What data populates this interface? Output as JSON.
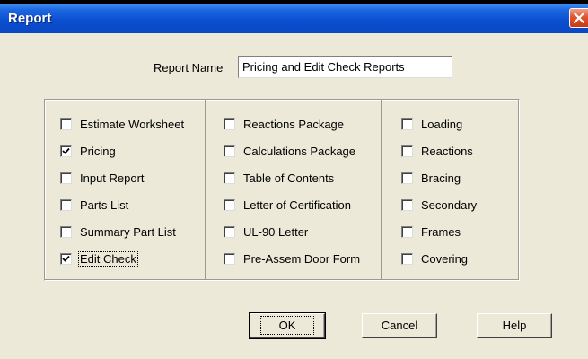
{
  "window": {
    "title": "Report",
    "close_icon": "close-icon"
  },
  "report_name": {
    "label": "Report Name",
    "value": "Pricing and Edit Check Reports"
  },
  "columns": [
    [
      {
        "label": "Estimate Worksheet",
        "checked": false
      },
      {
        "label": "Pricing",
        "checked": true
      },
      {
        "label": "Input Report",
        "checked": false
      },
      {
        "label": "Parts List",
        "checked": false
      },
      {
        "label": "Summary Part List",
        "checked": false
      },
      {
        "label": "Edit Check",
        "checked": true
      }
    ],
    [
      {
        "label": "Reactions Package",
        "checked": false
      },
      {
        "label": "Calculations Package",
        "checked": false
      },
      {
        "label": "Table of Contents",
        "checked": false
      },
      {
        "label": "Letter of Certification",
        "checked": false
      },
      {
        "label": "UL-90 Letter",
        "checked": false
      },
      {
        "label": "Pre-Assem Door Form",
        "checked": false
      }
    ],
    [
      {
        "label": "Loading",
        "checked": false
      },
      {
        "label": "Reactions",
        "checked": false
      },
      {
        "label": "Bracing",
        "checked": false
      },
      {
        "label": "Secondary",
        "checked": false
      },
      {
        "label": "Frames",
        "checked": false
      },
      {
        "label": "Covering",
        "checked": false
      }
    ]
  ],
  "buttons": {
    "ok": "OK",
    "cancel": "Cancel",
    "help": "Help"
  },
  "colors": {
    "titlebar": "#0a4fd0",
    "dialog_bg": "#ece9d8",
    "close_button": "#e0542e"
  }
}
